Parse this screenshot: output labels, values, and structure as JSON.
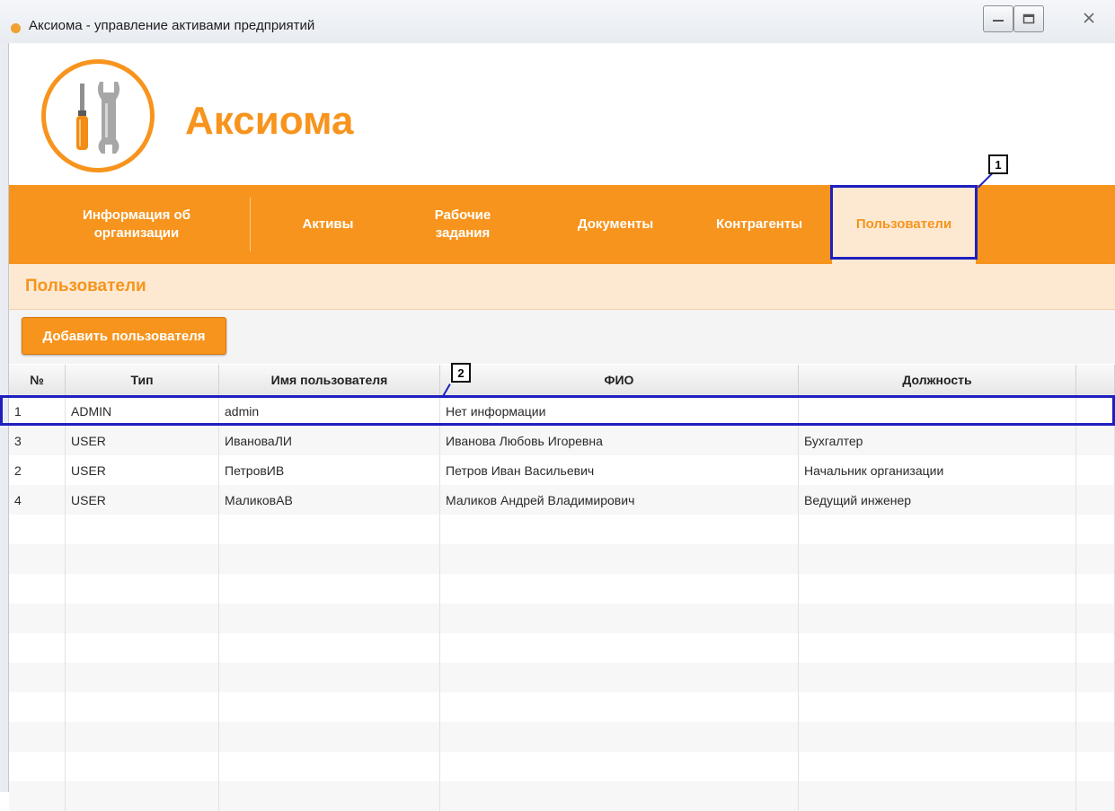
{
  "window": {
    "title": "Аксиома - управление активами предприятий"
  },
  "app": {
    "brand": "Аксиома"
  },
  "nav": {
    "items": [
      {
        "label": "Информация об\nорганизации"
      },
      {
        "label": "Активы"
      },
      {
        "label": "Рабочие\nзадания"
      },
      {
        "label": "Документы"
      },
      {
        "label": "Контрагенты"
      },
      {
        "label": "Пользователи",
        "active": true
      }
    ]
  },
  "section": {
    "title": "Пользователи"
  },
  "toolbar": {
    "add_user_label": "Добавить пользователя"
  },
  "table": {
    "columns": [
      "№",
      "Тип",
      "Имя пользователя",
      "ФИО",
      "Должность"
    ],
    "rows": [
      [
        "1",
        "ADMIN",
        "admin",
        "Нет информации",
        ""
      ],
      [
        "3",
        "USER",
        "ИвановаЛИ",
        "Иванова Любовь Игоревна",
        "Бухгалтер"
      ],
      [
        "2",
        "USER",
        "ПетровИВ",
        "Петров Иван Васильевич",
        "Начальник организации"
      ],
      [
        "4",
        "USER",
        "МаликовАВ",
        "Маликов Андрей Владимирович",
        "Ведущий инженер"
      ]
    ]
  },
  "annotations": {
    "label_1": "1",
    "label_2": "2"
  },
  "colors": {
    "brand": "#f7941d",
    "active_tab_bg": "#fde9d2",
    "annotation": "#1f1fbf"
  }
}
